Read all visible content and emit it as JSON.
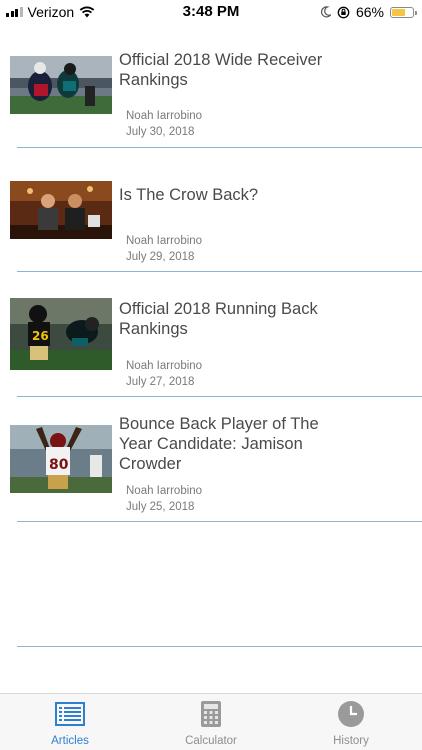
{
  "status_bar": {
    "carrier": "Verizon",
    "time": "3:48 PM",
    "battery": "66%",
    "battery_level": 0.66,
    "battery_color": "#f6c343"
  },
  "articles": [
    {
      "title": "Official 2018 Wide Receiver Rankings",
      "author": "Noah Iarrobino",
      "date": "July 30, 2018",
      "thumbnail": "football-catch-photo"
    },
    {
      "title": "Is The Crow Back?",
      "author": "Noah Iarrobino",
      "date": "July 29, 2018",
      "thumbnail": "podcast-hosts-photo"
    },
    {
      "title": "Official 2018 Running Back Rankings",
      "author": "Noah Iarrobino",
      "date": "July 27, 2018",
      "thumbnail": "steelers-runner-photo"
    },
    {
      "title": "Bounce Back Player of The Year Candidate: Jamison Crowder",
      "author": "Noah Iarrobino",
      "date": "July 25, 2018",
      "thumbnail": "redskins-receiver-photo"
    }
  ],
  "tab_bar": {
    "accent_color": "#2f7fd1",
    "tabs": [
      {
        "label": "Articles",
        "icon": "list-icon",
        "active": true
      },
      {
        "label": "Calculator",
        "icon": "calculator-icon",
        "active": false
      },
      {
        "label": "History",
        "icon": "clock-icon",
        "active": false
      }
    ]
  }
}
